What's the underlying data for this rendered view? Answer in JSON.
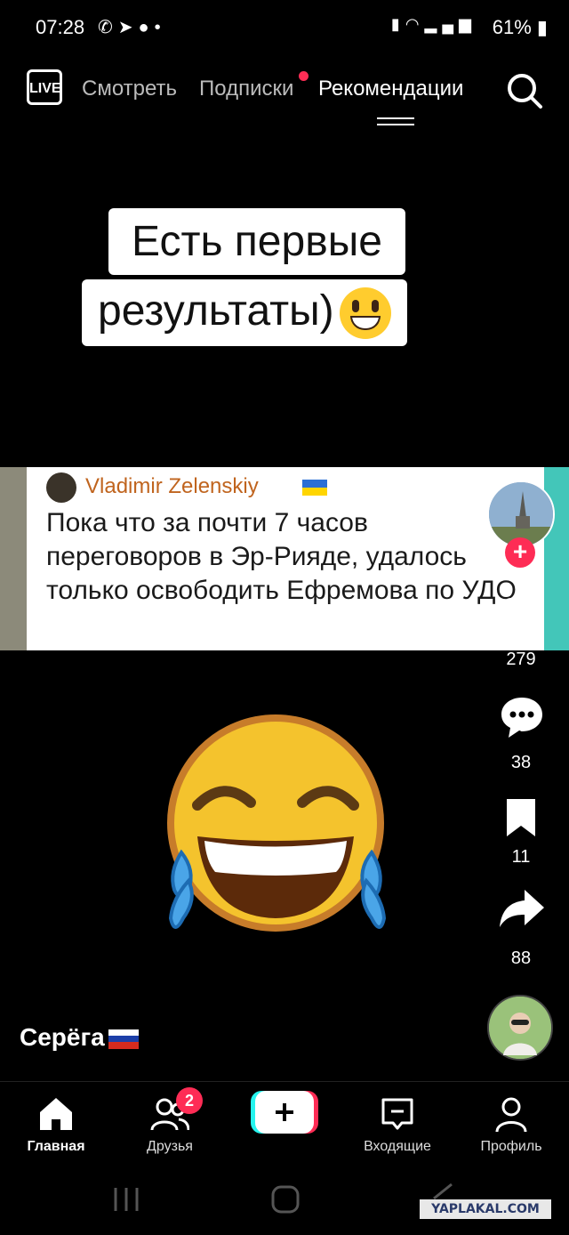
{
  "status_bar": {
    "time": "07:28",
    "left_icons": [
      "whatsapp-icon",
      "telegram-icon",
      "alert-icon",
      "dot"
    ],
    "battery": "61%"
  },
  "top_nav": {
    "live_label": "LIVE",
    "tabs": [
      {
        "label": "Смотреть",
        "active": false
      },
      {
        "label": "Подписки",
        "active": false,
        "has_dot": true
      },
      {
        "label": "Рекомендации",
        "active": true
      }
    ]
  },
  "caption": {
    "line1": "Есть первые",
    "line2": "результаты)",
    "emoji": "grinning-face"
  },
  "post": {
    "author": "Vladimir Zelenskiy",
    "text": "Пока что за почти 7 часов переговоров в Эр-Рияде, удалось только освободить Ефремова по УДО"
  },
  "actions": {
    "follow_symbol": "+",
    "likes": "279",
    "comments": "38",
    "bookmarks": "11",
    "shares": "88"
  },
  "creator": {
    "username": "Серёга"
  },
  "bottom_nav": {
    "items": [
      {
        "label": "Главная",
        "icon": "home-icon",
        "active": true
      },
      {
        "label": "Друзья",
        "icon": "friends-icon",
        "badge": "2"
      },
      {
        "label": "",
        "icon": "plus-icon"
      },
      {
        "label": "Входящие",
        "icon": "inbox-icon"
      },
      {
        "label": "Профиль",
        "icon": "profile-icon"
      }
    ],
    "create_symbol": "+"
  },
  "watermark": "YAPLAKAL.COM",
  "colors": {
    "accent_red": "#fe2c55",
    "accent_cyan": "#25f4ee",
    "author_orange": "#c0641e"
  }
}
